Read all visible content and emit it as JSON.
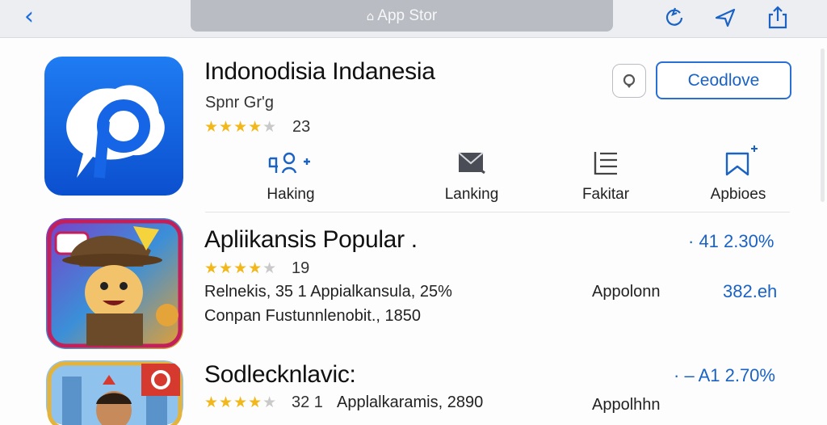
{
  "topbar": {
    "back_icon": "chevron-left-icon",
    "url": "App Stor",
    "actions": [
      "refresh-icon",
      "location-pin-icon",
      "share-icon"
    ]
  },
  "featured": {
    "title": "Indonodisia Indanesia",
    "subtitle": "Spnr Gr'g",
    "rating_count": "23",
    "rating_stars": 4.5,
    "get_label": "Ceodlove",
    "actions": [
      {
        "icon": "person-add-icon",
        "label": "Haking"
      },
      {
        "icon": "envelope-icon",
        "label": "Lanking"
      },
      {
        "icon": "list-icon",
        "label": "Fakitar"
      },
      {
        "icon": "bookmark-add-icon",
        "label": "Apbioes"
      }
    ]
  },
  "list": [
    {
      "title": "Apliikansis Popular .",
      "rating_count": "19",
      "rating_stars": 4.5,
      "line1": "Relnekis,  35 1   Appialkansula,  25%",
      "line2": "Conpan Fustunnlenobit.,  1850",
      "side_label": "Appolonn",
      "percent": "· 41 2.30%",
      "size": "382.eh"
    },
    {
      "title": "Sodlecknlavic:",
      "rating_count": "32 1",
      "rating_stars": 4.5,
      "line1": "Applalkaramis,  2890",
      "side_label": "Appolhhn",
      "percent": "· – A1 2.70%"
    }
  ],
  "colors": {
    "accent": "#1a62c4",
    "star": "#f2b81b",
    "icon_blue": "#1565e6"
  }
}
